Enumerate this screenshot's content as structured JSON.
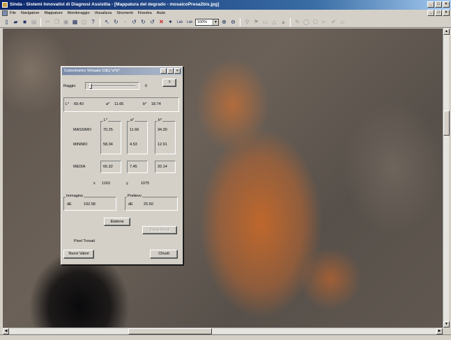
{
  "window": {
    "title": "Sinda - Sistemi Innovativi di Diagnosi Assistita - [Mappatura del degrado - mosaicoPresa2bis.jpg]"
  },
  "menu": [
    "File",
    "Navigatore",
    "Mappature",
    "Monitoraggio",
    "Visualizza",
    "Strumenti",
    "Finestra",
    "Aiuto"
  ],
  "toolbar": {
    "lab_label": "Lab",
    "lab2_label": "Lab",
    "zoom_value": "100%"
  },
  "dialog": {
    "title": "Colorimetro Virtuale CIEL*a*b*",
    "raggio_label": "Raggio",
    "raggio_value": "0",
    "help_label": "?",
    "current": {
      "L_label": "L*",
      "L": "69.40",
      "a_label": "a*",
      "a": "11.66",
      "b_label": "b*",
      "b": "18.74"
    },
    "col_headers": {
      "L": "L*",
      "a": "a*",
      "b": "b*"
    },
    "massimo": {
      "label": "MASSIMO",
      "L": "70.25",
      "a": "11.66",
      "b": "34.30"
    },
    "minimo": {
      "label": "MINIMO",
      "L": "58.34",
      "a": "4.53",
      "b": "12.91"
    },
    "media": {
      "label": "MEDIA",
      "L": "66.32",
      "a": "7.45",
      "b": "20.14"
    },
    "coords": {
      "x_label": "x",
      "x": "1163",
      "y_label": "y",
      "y": "1075"
    },
    "immagine": {
      "label": "Immagine",
      "de_label": "dE",
      "de": "192.58"
    },
    "prelievo": {
      "label": "Prelievo",
      "de_label": "dE",
      "de": "25.50"
    },
    "elabora_label": "Elabora",
    "trova_label": "Trova Bordi",
    "pixel_label": "Pixel Trovati",
    "nuovi_label": "Nuovi Valori",
    "chiudi_label": "Chiudi"
  },
  "colors": {
    "titlebar": "#0a246a",
    "dialog_titlebar": "#7a8aa8",
    "orange_degrado": "#c4682a"
  }
}
